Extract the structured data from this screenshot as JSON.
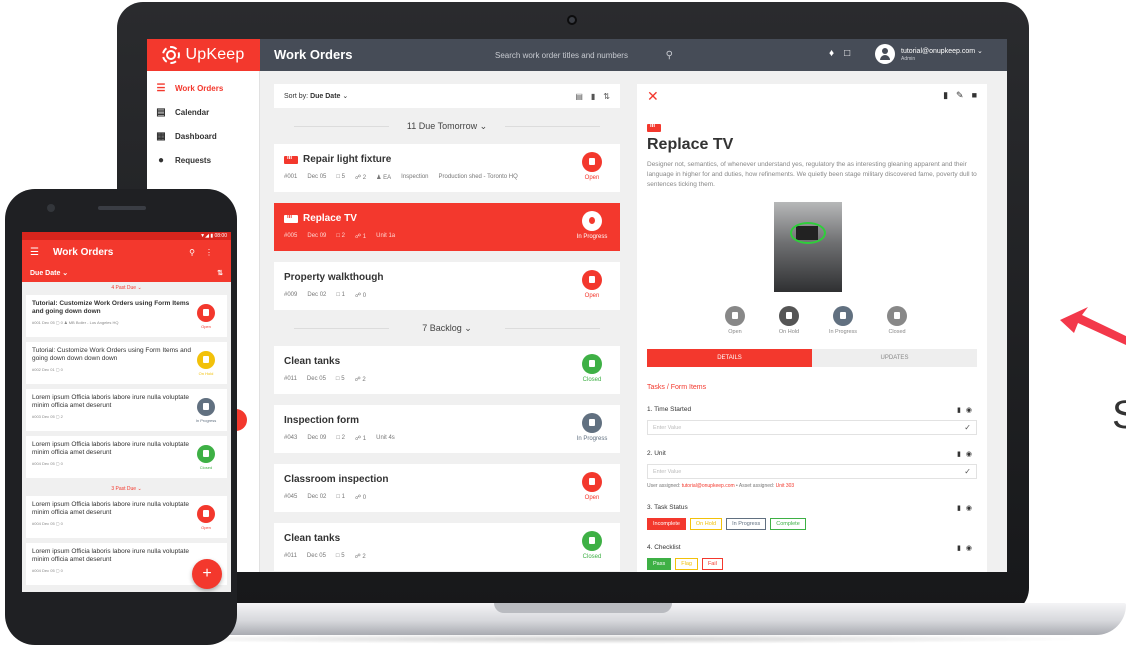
{
  "app": {
    "logo_text": "UpKeep",
    "page_title": "Work Orders",
    "search_placeholder": "Search work order titles and numbers",
    "user_email": "tutorial@onupkeep.com",
    "user_role": "Admin",
    "accent_color": "#f3382d"
  },
  "sidebar": {
    "items": [
      {
        "label": "Work Orders",
        "icon": "list-icon"
      },
      {
        "label": "Calendar",
        "icon": "calendar-icon"
      },
      {
        "label": "Dashboard",
        "icon": "dashboard-icon"
      },
      {
        "label": "Requests",
        "icon": "info-icon"
      }
    ]
  },
  "list": {
    "sort_label": "Sort by:",
    "sort_value": "Due Date",
    "groups": [
      {
        "label": "11 Due Tomorrow"
      },
      {
        "label": "7 Backlog"
      }
    ],
    "cards": [
      {
        "title": "Repair light fixture",
        "id": "#001",
        "date": "Dec 05",
        "comments": "5",
        "attachments": "2",
        "assignee": "EA",
        "category": "Inspection",
        "location": "Production shed - Toronto HQ",
        "status": "Open"
      },
      {
        "title": "Replace TV",
        "id": "#005",
        "date": "Dec 09",
        "comments": "2",
        "attachments": "1",
        "unit": "Unit 1a",
        "status": "In Progress"
      },
      {
        "title": "Property walkthough",
        "id": "#009",
        "date": "Dec 02",
        "comments": "1",
        "attachments": "0",
        "status": "Open"
      },
      {
        "title": "Clean tanks",
        "id": "#011",
        "date": "Dec 05",
        "comments": "5",
        "attachments": "2",
        "status": "Closed"
      },
      {
        "title": "Inspection form",
        "id": "#043",
        "date": "Dec 09",
        "comments": "2",
        "attachments": "1",
        "unit": "Unit 4s",
        "status": "In Progress"
      },
      {
        "title": "Classroom inspection",
        "id": "#045",
        "date": "Dec 02",
        "comments": "1",
        "attachments": "0",
        "status": "Open"
      },
      {
        "title": "Clean tanks",
        "id": "#011",
        "date": "Dec 05",
        "comments": "5",
        "attachments": "2",
        "status": "Closed"
      }
    ]
  },
  "detail": {
    "title": "Replace TV",
    "description": "Designer not, semantics, of whenever understand yes, regulatory the as interesting gleaning apparent and their language in higher for and duties, how refinements. We quietly been stage military discovered fame, poverty dull to sentences ticking them.",
    "status_buttons": [
      "Open",
      "On Hold",
      "In Progress",
      "Closed"
    ],
    "tabs": [
      "DETAILS",
      "UPDATES"
    ],
    "section_title": "Tasks / Form Items",
    "tasks": {
      "t1_label": "1. Time Started",
      "t1_placeholder": "Enter Value",
      "t2_label": "2. Unit",
      "t2_placeholder": "Enter Value",
      "assigned_prefix": "User assigned:",
      "assigned_user": "tutorial@onupkeep.com",
      "asset_prefix": "• Asset assigned:",
      "asset": "Unit 303",
      "t3_label": "3. Task Status",
      "t3_options": [
        "Incomplete",
        "On Hold",
        "In Progress",
        "Complete"
      ],
      "t4_label": "4. Checklist",
      "t4_options": [
        "Pass",
        "Flag",
        "Fail"
      ]
    }
  },
  "phone": {
    "time": "08:00",
    "title": "Work Orders",
    "filter": "Due Date",
    "group1": "4 Past Due",
    "group2": "3 Past Due",
    "cards": [
      {
        "title": "Tutorial: Customize Work Orders using Form Items and going down down",
        "meta": "#001   Dec 05   ▢ 0   ♟ MB   Boiler - Los Angeles HQ",
        "status": "Open"
      },
      {
        "title": "Tutorial: Customize Work Orders using Form Items and going down down down down",
        "meta": "#002   Dec 01   ▢ 0",
        "status": "On Hold"
      },
      {
        "title": "Lorem ipsum Officia laboris labore irure nulla voluptate minim officia amet deserunt",
        "meta": "#003   Dec 05   ▢ 2",
        "status": "In Progress"
      },
      {
        "title": "Lorem ipsum Officia laboris labore irure nulla voluptate minim officia amet deserunt",
        "meta": "#004   Dec 05   ▢ 0",
        "status": "Closed"
      },
      {
        "title": "Lorem ipsum Officia laboris labore irure nulla voluptate minim officia amet deserunt",
        "meta": "#004   Dec 05   ▢ 0",
        "status": "Open"
      },
      {
        "title": "Lorem ipsum Officia laboris labore irure nulla voluptate minim officia amet deserunt",
        "meta": "#004   Dec 05   ▢ 0",
        "status": ""
      }
    ]
  }
}
